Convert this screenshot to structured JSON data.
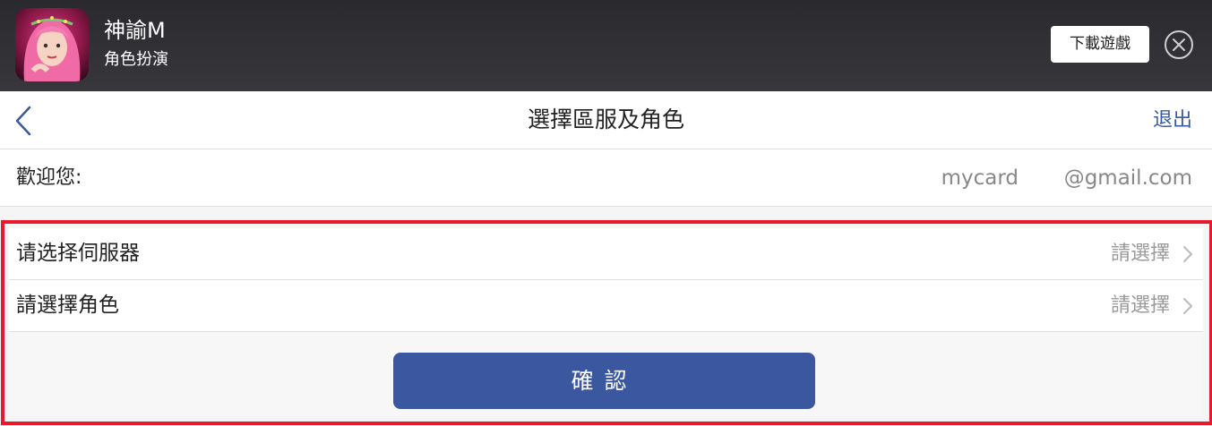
{
  "promo": {
    "app_name": "神諭M",
    "app_genre": "角色扮演",
    "download_label": "下載遊戲",
    "icon": "game-character-icon"
  },
  "header": {
    "title": "選擇區服及角色",
    "logout_label": "退出",
    "back_icon": "chevron-left-icon"
  },
  "welcome": {
    "label": "歡迎您:",
    "user": "mycard",
    "domain": "@gmail.com"
  },
  "form": {
    "server_label": "请选择伺服器",
    "server_value": "請選擇",
    "role_label": "請選擇角色",
    "role_value": "請選擇",
    "confirm_label": "確認"
  },
  "colors": {
    "accent": "#3a57a0",
    "highlight": "#e8192c",
    "banner": "#2e2e32"
  }
}
